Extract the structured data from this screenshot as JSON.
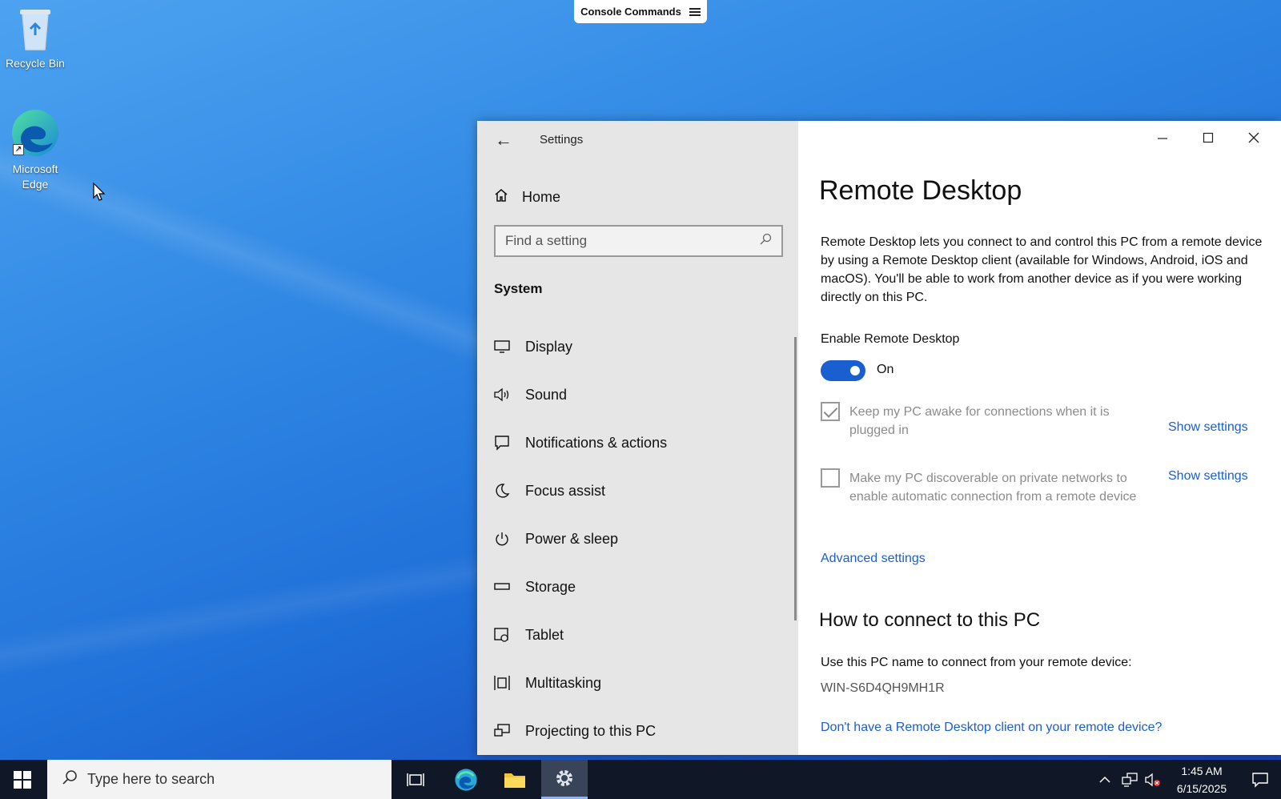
{
  "desktop": {
    "icons": [
      {
        "label": "Recycle Bin"
      },
      {
        "label_line1": "Microsoft",
        "label_line2": "Edge"
      }
    ],
    "console_button": "Console Commands"
  },
  "window": {
    "title": "Settings",
    "nav": {
      "home": "Home",
      "search_placeholder": "Find a setting",
      "section": "System",
      "items": [
        {
          "label": "Display",
          "icon": "display-icon"
        },
        {
          "label": "Sound",
          "icon": "sound-icon"
        },
        {
          "label": "Notifications & actions",
          "icon": "notifications-icon"
        },
        {
          "label": "Focus assist",
          "icon": "moon-icon"
        },
        {
          "label": "Power & sleep",
          "icon": "power-icon"
        },
        {
          "label": "Storage",
          "icon": "storage-icon"
        },
        {
          "label": "Tablet",
          "icon": "tablet-icon"
        },
        {
          "label": "Multitasking",
          "icon": "multitasking-icon"
        },
        {
          "label": "Projecting to this PC",
          "icon": "projecting-icon"
        }
      ]
    },
    "content": {
      "title": "Remote Desktop",
      "description": "Remote Desktop lets you connect to and control this PC from a remote device by using a Remote Desktop client (available for Windows, Android, iOS and macOS). You'll be able to work from another device as if you were working directly on this PC.",
      "enable_label": "Enable Remote Desktop",
      "toggle_state": "On",
      "options": [
        {
          "text": "Keep my PC awake for connections when it is plugged in",
          "checked": true,
          "link": "Show settings"
        },
        {
          "text": "Make my PC discoverable on private networks to enable automatic connection from a remote device",
          "checked": false,
          "link": "Show settings"
        }
      ],
      "advanced_link": "Advanced settings",
      "how_to_title": "How to connect to this PC",
      "use_pc_name": "Use this PC name to connect from your remote device:",
      "pc_name": "WIN-S6D4QH9MH1R",
      "no_client_link": "Don't have a Remote Desktop client on your remote device?"
    }
  },
  "taskbar": {
    "search_placeholder": "Type here to search",
    "time": "1:45 AM",
    "date": "6/15/2025"
  },
  "colors": {
    "accent": "#1a5fd0",
    "taskbar": "#101828"
  }
}
